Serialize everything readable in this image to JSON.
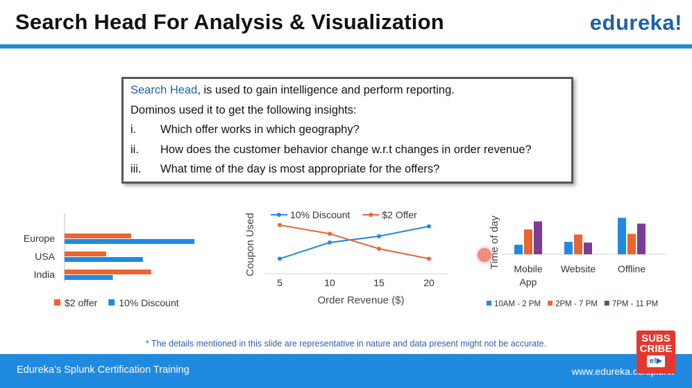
{
  "slide": {
    "title": "Search Head For Analysis & Visualization",
    "logo": "edureka!",
    "footnote": "* The details mentioned in this slide are representative in nature and data present might not be accurate.",
    "footer_left": "Edureka’s Splunk Certification Training",
    "footer_right": "www.edureka.co/splunk",
    "subscribe_line1": "SUBS",
    "subscribe_line2": "CRIBE",
    "subscribe_logo": "e!▶"
  },
  "textbox": {
    "highlight": "Search Head",
    "line1_rest": ", is used to gain intelligence and perform reporting.",
    "line2": "Dominos used it to get the following insights:",
    "items": [
      {
        "num": "i.",
        "text": "Which offer works in which geography?"
      },
      {
        "num": "ii.",
        "text": "How does the customer behavior change w.r.t changes in order revenue?"
      },
      {
        "num": "iii.",
        "text": "What time of the day is most appropriate for the offers?"
      }
    ]
  },
  "colors": {
    "blue": "#1f8ae0",
    "orange": "#ee6330",
    "purple": "#7a3d98",
    "text_blue": "#1f5fa8"
  },
  "chart_data": [
    {
      "type": "bar",
      "orientation": "horizontal",
      "categories": [
        "Europe",
        "USA",
        "India"
      ],
      "series": [
        {
          "name": "$2 offer",
          "values": [
            40,
            25,
            52
          ]
        },
        {
          "name": "10% Discount",
          "values": [
            78,
            47,
            29
          ]
        }
      ],
      "xlim": [
        0,
        100
      ],
      "legend": "bottom"
    },
    {
      "type": "line",
      "x": [
        5,
        10,
        15,
        20
      ],
      "series": [
        {
          "name": "10% Discount",
          "values": [
            1.2,
            2.5,
            3.0,
            3.8
          ]
        },
        {
          "name": "$2 Offer",
          "values": [
            3.9,
            3.2,
            2.0,
            1.2
          ]
        }
      ],
      "xlabel": "Order Revenue ($)",
      "ylabel": "Coupon Used",
      "ylim": [
        0,
        5
      ],
      "legend": "top"
    },
    {
      "type": "bar",
      "categories": [
        "Mobile\nApp",
        "Website",
        "Offline"
      ],
      "series": [
        {
          "name": "10AM - 2 PM",
          "values": [
            1.3,
            1.7,
            5.0
          ]
        },
        {
          "name": "2PM - 7 PM",
          "values": [
            3.4,
            2.7,
            2.8
          ]
        },
        {
          "name": "7PM - 11 PM",
          "values": [
            4.5,
            1.6,
            4.2
          ]
        }
      ],
      "ylabel": "Time of day",
      "ylim": [
        0,
        5.5
      ],
      "legend": "bottom"
    }
  ]
}
